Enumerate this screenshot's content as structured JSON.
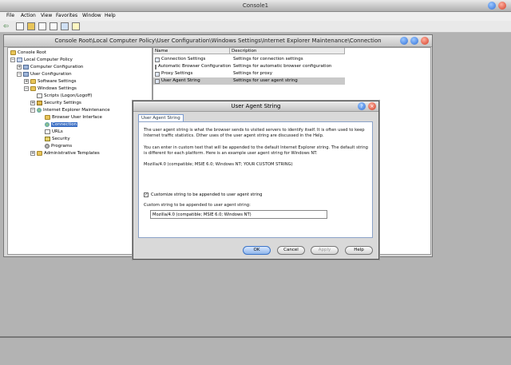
{
  "console": {
    "title": "Console1",
    "menu": [
      "File",
      "Action",
      "View",
      "Favorites",
      "Window",
      "Help"
    ]
  },
  "inner_window": {
    "title": "Console Root\\Local Computer Policy\\User Configuration\\Windows Settings\\Internet Explorer Maintenance\\Connection"
  },
  "tree": {
    "nodes": [
      {
        "label": "Console Root",
        "icon": "folder-icon"
      },
      {
        "label": "Local Computer Policy",
        "icon": "policy-icon",
        "expander": "−"
      },
      {
        "label": "Computer Configuration",
        "icon": "computer-icon",
        "expander": "+"
      },
      {
        "label": "User Configuration",
        "icon": "computer-icon",
        "expander": "−"
      },
      {
        "label": "Software Settings",
        "icon": "folder-icon",
        "expander": "+"
      },
      {
        "label": "Windows Settings",
        "icon": "folder-icon",
        "expander": "−"
      },
      {
        "label": "Scripts (Logon/Logoff)",
        "icon": "doc-icon"
      },
      {
        "label": "Security Settings",
        "icon": "lock-icon",
        "expander": "+"
      },
      {
        "label": "Internet Explorer Maintenance",
        "icon": "globe-icon",
        "expander": "−"
      },
      {
        "label": "Browser User Interface",
        "icon": "folder-icon"
      },
      {
        "label": "Connection",
        "icon": "globe-icon",
        "selected": true
      },
      {
        "label": "URLs",
        "icon": "doc-icon"
      },
      {
        "label": "Security",
        "icon": "key-icon"
      },
      {
        "label": "Programs",
        "icon": "gear-icon"
      },
      {
        "label": "Administrative Templates",
        "icon": "folder-icon",
        "expander": "+"
      }
    ]
  },
  "list": {
    "columns": [
      "Name",
      "Description"
    ],
    "rows": [
      {
        "name": "Connection Settings",
        "description": "Settings for connection settings"
      },
      {
        "name": "Automatic Browser Configuration",
        "description": "Settings for automatic browser configuration"
      },
      {
        "name": "Proxy Settings",
        "description": "Settings for proxy"
      },
      {
        "name": "User Agent String",
        "description": "Settings for user agent string"
      }
    ]
  },
  "dialog": {
    "title": "User Agent String",
    "tab": "User Agent String",
    "para1": "The user agent string is what the browser sends to visited servers to identify itself. It is often used to keep Internet traffic statistics. Other uses of the user agent string are discussed in the Help.",
    "para2": "You can enter in custom text that will be appended to the default Internet Explorer string. The default string is different for each platform. Here is an example user agent string for Windows NT:",
    "example": "Mozilla/4.0 (compatible; MSIE 6.0; Windows NT; YOUR CUSTOM STRING)",
    "checkbox_label": "Customize string to be appended to user agent string",
    "checkbox_checked": true,
    "field_label": "Custom string to be appended to user agent string:",
    "field_value": "Mozilla/4.0 (compatible; MSIE 6.0; Windows NT)",
    "buttons": {
      "ok": "OK",
      "cancel": "Cancel",
      "apply": "Apply",
      "help": "Help"
    }
  }
}
